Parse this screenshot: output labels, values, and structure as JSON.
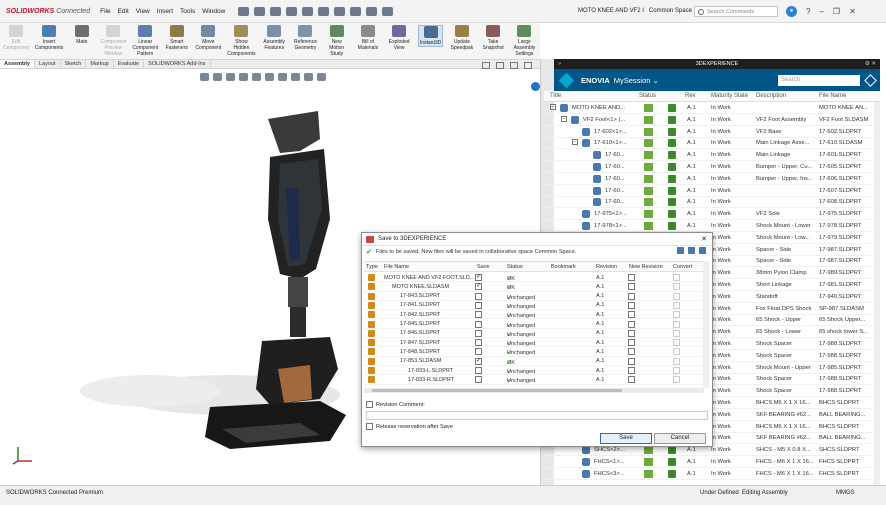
{
  "app": {
    "brand": "SOLIDWORKS",
    "brand_suffix": "Connected",
    "doc_title": "MOTO KNEE AND VF2 I",
    "space": "Common Space"
  },
  "menu": [
    "File",
    "Edit",
    "View",
    "Insert",
    "Tools",
    "Window"
  ],
  "search": {
    "placeholder": "Search Commands"
  },
  "ribbon": [
    {
      "label": "Edit\nComponent",
      "disabled": true,
      "color": "#8a9bb0"
    },
    {
      "label": "Insert\nComponents",
      "disabled": false,
      "color": "#4e7db6"
    },
    {
      "label": "Mate",
      "disabled": false,
      "color": "#6d6d6d"
    },
    {
      "label": "Component\nPreview\nWindow",
      "disabled": true,
      "color": "#8a9bb0"
    },
    {
      "label": "Linear Component\nPattern",
      "disabled": false,
      "color": "#5b7fa8"
    },
    {
      "label": "Smart\nFasteners",
      "disabled": false,
      "color": "#8c7a4c"
    },
    {
      "label": "Move\nComponent",
      "disabled": false,
      "color": "#6f8aa7"
    },
    {
      "label": "Show\nHidden\nComponents",
      "disabled": false,
      "color": "#a08c5c"
    },
    {
      "label": "Assembly\nFeatures",
      "disabled": false,
      "color": "#7b8fa6"
    },
    {
      "label": "Reference\nGeometry",
      "disabled": false,
      "color": "#7c93ad"
    },
    {
      "label": "New\nMotion\nStudy",
      "disabled": false,
      "color": "#5d8a5b"
    },
    {
      "label": "Bill of\nMaterials",
      "disabled": false,
      "color": "#8b8b8b"
    },
    {
      "label": "Exploded\nView",
      "disabled": false,
      "color": "#6c6c9c"
    },
    {
      "label": "Instant3D",
      "disabled": false,
      "active": true,
      "color": "#4a6b8c"
    },
    {
      "label": "Update\nSpeedpak",
      "disabled": false,
      "color": "#9c7d4a"
    },
    {
      "label": "Take\nSnapshot",
      "disabled": false,
      "color": "#8b5a5a"
    },
    {
      "label": "Large\nAssembly\nSettings",
      "disabled": false,
      "color": "#5e8c5e"
    }
  ],
  "tabs": [
    {
      "label": "Assembly",
      "active": true
    },
    {
      "label": "Layout",
      "active": false
    },
    {
      "label": "Sketch",
      "active": false
    },
    {
      "label": "Markup",
      "active": false
    },
    {
      "label": "Evaluate",
      "active": false
    },
    {
      "label": "SOLIDWORKS Add-Ins",
      "active": false
    }
  ],
  "dx_panel": {
    "header": "3DEXPERIENCE",
    "app_name": "ENOVIA",
    "session": "MySession",
    "search_placeholder": "Search",
    "columns": [
      "Title",
      "Status",
      "Rev",
      "Maturity State",
      "Description",
      "File Name"
    ],
    "rows": [
      {
        "indent": 0,
        "expander": "−",
        "title": "MOTO KNEE AND...",
        "rev": "A.1",
        "state": "In Work",
        "desc": "",
        "file": "MOTO KNEE AN..."
      },
      {
        "indent": 1,
        "expander": "−",
        "title": "VF2 Foot<1> (...",
        "rev": "A.1",
        "state": "In Work",
        "desc": "VF2 Foot Assembly",
        "file": "VF2 Foot SLDASM"
      },
      {
        "indent": 2,
        "expander": "",
        "title": "17-602<1>...",
        "rev": "A.1",
        "state": "In Work",
        "desc": "VF2 Base",
        "file": "17-602.SLDPRT"
      },
      {
        "indent": 2,
        "expander": "−",
        "title": "17-610<1>...",
        "rev": "A.1",
        "state": "In Work",
        "desc": "Main Linkage Asse...",
        "file": "17-610.SLDASM"
      },
      {
        "indent": 3,
        "expander": "",
        "title": "17-60...",
        "rev": "A.1",
        "state": "In Work",
        "desc": "Main Linkage",
        "file": "17-601.SLDPRT"
      },
      {
        "indent": 3,
        "expander": "",
        "title": "17-60...",
        "rev": "A.1",
        "state": "In Work",
        "desc": "Bumper - Upper, Cu...",
        "file": "17-605.SLDPRT"
      },
      {
        "indent": 3,
        "expander": "",
        "title": "17-60...",
        "rev": "A.1",
        "state": "In Work",
        "desc": "Bumper - Upper, Ins...",
        "file": "17-606.SLDPRT"
      },
      {
        "indent": 3,
        "expander": "",
        "title": "17-60...",
        "rev": "A.1",
        "state": "In Work",
        "desc": "",
        "file": "17-607.SLDPRT"
      },
      {
        "indent": 3,
        "expander": "",
        "title": "17-60...",
        "rev": "A.1",
        "state": "In Work",
        "desc": "",
        "file": "17-608.SLDPRT"
      },
      {
        "indent": 2,
        "expander": "",
        "title": "17-975<1>...",
        "rev": "A.1",
        "state": "In Work",
        "desc": "VF2 Sole",
        "file": "17-975.SLDPRT"
      },
      {
        "indent": 2,
        "expander": "",
        "title": "17-978<1>...",
        "rev": "A.1",
        "state": "In Work",
        "desc": "Shock Mount - Lower",
        "file": "17-978.SLDPRT"
      },
      {
        "indent": 2,
        "expander": "",
        "title": "",
        "rev": "",
        "state": "In Work",
        "desc": "Shock Mount - Low...",
        "file": "17-979.SLDPRT"
      },
      {
        "indent": 2,
        "expander": "",
        "title": "",
        "rev": "",
        "state": "In Work",
        "desc": "Spacer - Side",
        "file": "17-987.SLDPRT"
      },
      {
        "indent": 2,
        "expander": "",
        "title": "",
        "rev": "",
        "state": "In Work",
        "desc": "Spacer - Side",
        "file": "17-987.SLDPRT"
      },
      {
        "indent": 2,
        "expander": "",
        "title": "",
        "rev": "",
        "state": "In Work",
        "desc": "38mm Pylon Clamp",
        "file": "17-989.SLDPRT"
      },
      {
        "indent": 2,
        "expander": "",
        "title": "",
        "rev": "",
        "state": "In Work",
        "desc": "Short Linkage",
        "file": "17-981.SLDPRT"
      },
      {
        "indent": 2,
        "expander": "",
        "title": "",
        "rev": "",
        "state": "In Work",
        "desc": "Standoff",
        "file": "17-940.SLDPRT"
      },
      {
        "indent": 2,
        "expander": "",
        "title": "",
        "rev": "",
        "state": "In Work",
        "desc": "Fox Float DPS Shock",
        "file": "SP-987.SLDASM"
      },
      {
        "indent": 2,
        "expander": "",
        "title": "",
        "rev": "",
        "state": "In Work",
        "desc": "65 Shock - Upper",
        "file": "65 Shock Upper..."
      },
      {
        "indent": 2,
        "expander": "",
        "title": "",
        "rev": "",
        "state": "In Work",
        "desc": "65 Shock - Lower",
        "file": "65 shock lower S..."
      },
      {
        "indent": 2,
        "expander": "",
        "title": "",
        "rev": "",
        "state": "In Work",
        "desc": "Shock Spacer",
        "file": "17-988.SLDPRT"
      },
      {
        "indent": 2,
        "expander": "",
        "title": "",
        "rev": "",
        "state": "In Work",
        "desc": "Shock Spacer",
        "file": "17-988.SLDPRT"
      },
      {
        "indent": 2,
        "expander": "",
        "title": "",
        "rev": "",
        "state": "In Work",
        "desc": "Shock Mount - Upper",
        "file": "17-985.SLDPRT"
      },
      {
        "indent": 2,
        "expander": "",
        "title": "",
        "rev": "",
        "state": "In Work",
        "desc": "Shock Spacer",
        "file": "17-988.SLDPRT"
      },
      {
        "indent": 2,
        "expander": "",
        "title": "",
        "rev": "",
        "state": "In Work",
        "desc": "Shock Spacer",
        "file": "17-988.SLDPRT"
      },
      {
        "indent": 2,
        "expander": "",
        "title": "",
        "rev": "",
        "state": "In Work",
        "desc": "BHCS M6 X 1 X 16...",
        "file": "BHCS SLDPRT"
      },
      {
        "indent": 2,
        "expander": "",
        "title": "",
        "rev": "",
        "state": "In Work",
        "desc": "SKF BEARING #62...",
        "file": "BALL BEARING..."
      },
      {
        "indent": 2,
        "expander": "",
        "title": "",
        "rev": "",
        "state": "In Work",
        "desc": "BHCS M6 X 1 X 16...",
        "file": "BHCS SLDPRT"
      },
      {
        "indent": 2,
        "expander": "",
        "title": "",
        "rev": "",
        "state": "In Work",
        "desc": "SKF BEARING #62...",
        "file": "BALL BEARING..."
      },
      {
        "indent": 2,
        "expander": "",
        "title": "SHCS<2>...",
        "rev": "A.1",
        "state": "In Work",
        "desc": "SHCS - M5 X 0.8 X...",
        "file": "SHCS SLDPRT"
      },
      {
        "indent": 2,
        "expander": "",
        "title": "FHCS<1>...",
        "rev": "A.1",
        "state": "In Work",
        "desc": "FHCS - M6 X 1 X 16...",
        "file": "FHCS SLDPRT"
      },
      {
        "indent": 2,
        "expander": "",
        "title": "FHCS<3>...",
        "rev": "A.1",
        "state": "In Work",
        "desc": "FHCS - M6 X 1 X 16...",
        "file": "FHCS SLDPRT"
      }
    ]
  },
  "dialog": {
    "title": "Save to 3DEXPERIENCE",
    "message": "Files to be saved. New files will be saved in collaborative space Common Space.",
    "columns": [
      "Type",
      "File Name",
      "Save",
      "Status",
      "Bookmark",
      "Revision",
      "New Revision",
      "Convert"
    ],
    "rows": [
      {
        "name": "MOTO KNEE AND VF2 FOOT.SLD...",
        "indent": 0,
        "save": true,
        "status": "OK",
        "rev": "A.1"
      },
      {
        "name": "MOTO KNEE.SLDASM",
        "indent": 1,
        "save": true,
        "status": "OK",
        "rev": "A.1"
      },
      {
        "name": "17-843.SLDPRT",
        "indent": 2,
        "save": false,
        "status": "Unchanged",
        "rev": "A.1"
      },
      {
        "name": "17-841.SLDPRT",
        "indent": 2,
        "save": false,
        "status": "Unchanged",
        "rev": "A.1"
      },
      {
        "name": "17-842.SLDPRT",
        "indent": 2,
        "save": false,
        "status": "Unchanged",
        "rev": "A.1"
      },
      {
        "name": "17-845.SLDPRT",
        "indent": 2,
        "save": false,
        "status": "Unchanged",
        "rev": "A.1"
      },
      {
        "name": "17-846.SLDPRT",
        "indent": 2,
        "save": false,
        "status": "Unchanged",
        "rev": "A.1"
      },
      {
        "name": "17-847.SLDPRT",
        "indent": 2,
        "save": false,
        "status": "Unchanged",
        "rev": "A.1"
      },
      {
        "name": "17-848.SLDPRT",
        "indent": 2,
        "save": false,
        "status": "Unchanged",
        "rev": "A.1"
      },
      {
        "name": "17-853.SLDASM",
        "indent": 2,
        "save": true,
        "status": "OK",
        "rev": "A.1"
      },
      {
        "name": "17-833-L.SLDPRT",
        "indent": 3,
        "save": false,
        "status": "Unchanged",
        "rev": "A.1"
      },
      {
        "name": "17-833-R.SLDPRT",
        "indent": 3,
        "save": false,
        "status": "Unchanged",
        "rev": "A.1"
      }
    ],
    "revision_comment": "Revision Comment:",
    "release_label": "Release reservation after Save",
    "save_label": "Save",
    "cancel_label": "Cancel"
  },
  "status": {
    "left": "SOLIDWORKS Connected Premium",
    "units": "Under Defined",
    "mode": "Editing Assembly",
    "system": "MMGS"
  }
}
